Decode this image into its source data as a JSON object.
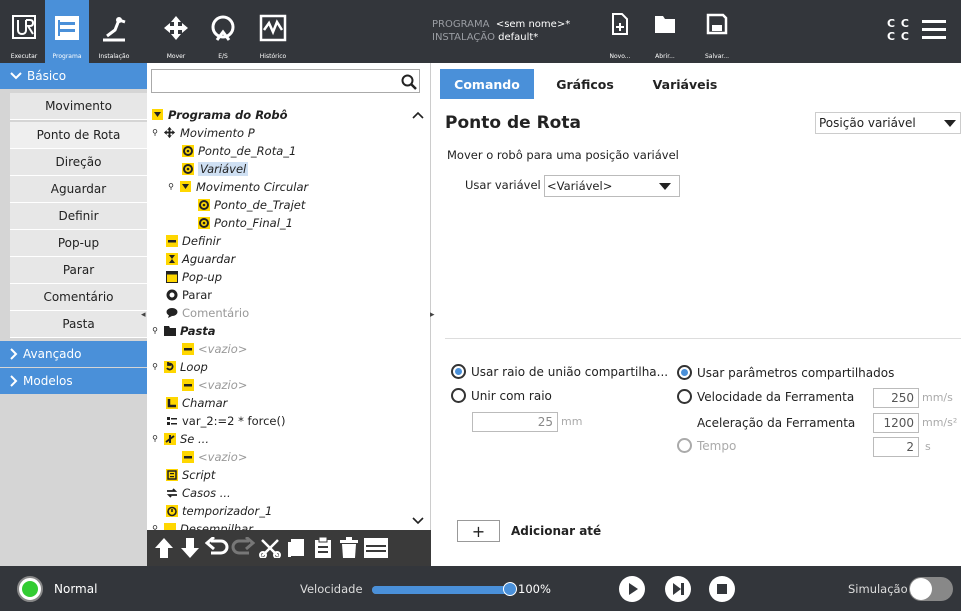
{
  "topbar": {
    "tabs": [
      {
        "label": "Executar",
        "icon": "ur-logo-icon"
      },
      {
        "label": "Programa",
        "icon": "program-icon"
      },
      {
        "label": "Instalação",
        "icon": "installation-icon"
      },
      {
        "label": "Mover",
        "icon": "move-icon"
      },
      {
        "label": "E/S",
        "icon": "io-icon"
      },
      {
        "label": "Histórico",
        "icon": "log-icon"
      }
    ],
    "program_label": "PROGRAMA",
    "program_value": "<sem nome>*",
    "installation_label": "INSTALAÇÃO",
    "installation_value": "default*",
    "file_buttons": {
      "new": "Novo...",
      "open": "Abrir...",
      "save": "Salvar..."
    },
    "cc_line1": "C C",
    "cc_line2": "C C"
  },
  "leftnav": {
    "basic": "Básico",
    "advanced": "Avançado",
    "templates": "Modelos",
    "items": [
      "Movimento",
      "Ponto de Rota",
      "Direção",
      "Aguardar",
      "Definir",
      "Pop-up",
      "Parar",
      "Comentário",
      "Pasta"
    ]
  },
  "tree": {
    "rows": [
      {
        "text": "Programa do Robô"
      },
      {
        "text": "Movimento P"
      },
      {
        "text": "Ponto_de_Rota_1"
      },
      {
        "text": "Variável"
      },
      {
        "text": "Movimento Circular"
      },
      {
        "text": "Ponto_de_Trajet"
      },
      {
        "text": "Ponto_Final_1"
      },
      {
        "text": "Definir"
      },
      {
        "text": "Aguardar"
      },
      {
        "text": "Pop-up"
      },
      {
        "text": "Parar"
      },
      {
        "text": "Comentário"
      },
      {
        "text": "Pasta"
      },
      {
        "text": "<vazio>"
      },
      {
        "text": "Loop"
      },
      {
        "text": "<vazio>"
      },
      {
        "text": "Chamar"
      },
      {
        "text": "var_2:=2 * force()"
      },
      {
        "text": "Se ..."
      },
      {
        "text": "<vazio>"
      },
      {
        "text": "Script"
      },
      {
        "text": "Casos ..."
      },
      {
        "text": "temporizador_1"
      },
      {
        "text": "Desempilhar"
      }
    ]
  },
  "tabs": [
    "Comando",
    "Gráficos",
    "Variáveis"
  ],
  "content": {
    "title": "Ponto de Rota",
    "type_select": "Posição variável",
    "description": "Mover o robô para uma posição variável",
    "use_variable_label": "Usar variável",
    "variable_select": "<Variável>",
    "blend_shared": "Usar raio de união compartilha...",
    "blend_radius": "Unir com raio",
    "blend_value": "25",
    "blend_unit": "mm",
    "params_shared": "Usar parâmetros compartilhados",
    "tool_speed": "Velocidade da Ferramenta",
    "tool_speed_value": "250",
    "tool_speed_unit": "mm/s",
    "tool_accel": "Aceleração da Ferramenta",
    "tool_accel_value": "1200",
    "tool_accel_unit": "mm/s²",
    "time": "Tempo",
    "time_value": "2",
    "time_unit": "s",
    "add_until_symbol": "+",
    "add_until": "Adicionar até"
  },
  "bottombar": {
    "status": "Normal",
    "speed_label": "Velocidade",
    "speed_value": "100%",
    "speed_fraction": 1.0,
    "simulation": "Simulação"
  },
  "colors": {
    "accent": "#4a90d9",
    "topbar": "#33363b",
    "status_green": "#33cc33",
    "highlight": "#cfe0f3",
    "icon_yellow": "#ffd700"
  }
}
